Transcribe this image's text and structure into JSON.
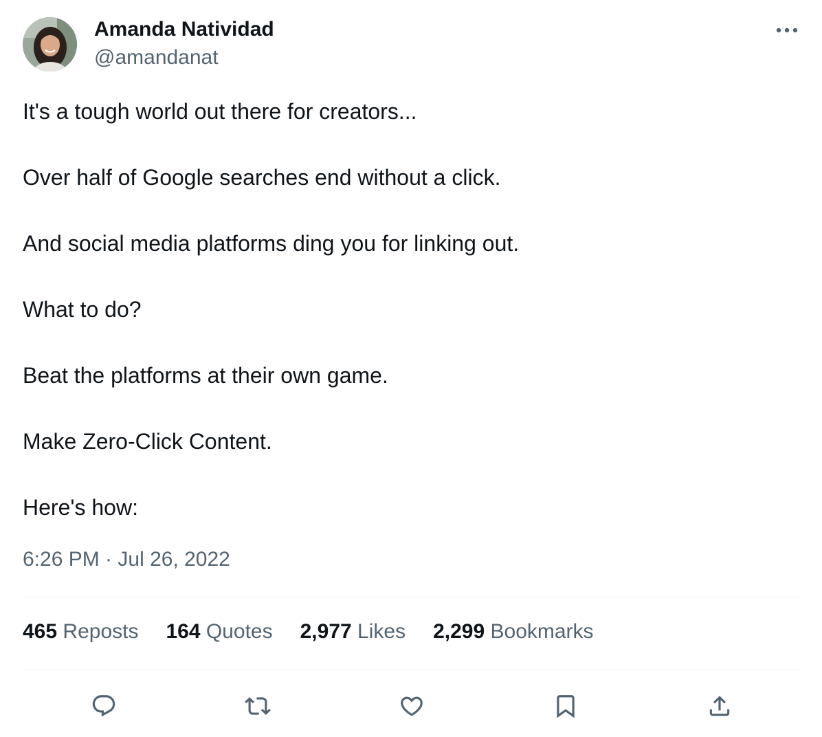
{
  "author": {
    "name": "Amanda Natividad",
    "handle": "@amandanat"
  },
  "tweet": {
    "lines": [
      "It's a tough world out there for creators...",
      "Over half of Google searches end without a click.",
      "And social media platforms ding you for linking out.",
      "What to do?",
      "Beat the platforms at their own game.",
      "Make Zero-Click Content.",
      "Here's how:"
    ],
    "timestamp": "6:26 PM · Jul 26, 2022"
  },
  "stats": {
    "reposts": {
      "count": "465",
      "label": "Reposts"
    },
    "quotes": {
      "count": "164",
      "label": "Quotes"
    },
    "likes": {
      "count": "2,977",
      "label": "Likes"
    },
    "bookmarks": {
      "count": "2,299",
      "label": "Bookmarks"
    }
  },
  "actions": [
    "reply-icon",
    "repost-icon",
    "like-icon",
    "bookmark-icon",
    "share-icon"
  ],
  "colors": {
    "text": "#0f1419",
    "secondary": "#536471",
    "divider": "#eff3f4"
  }
}
